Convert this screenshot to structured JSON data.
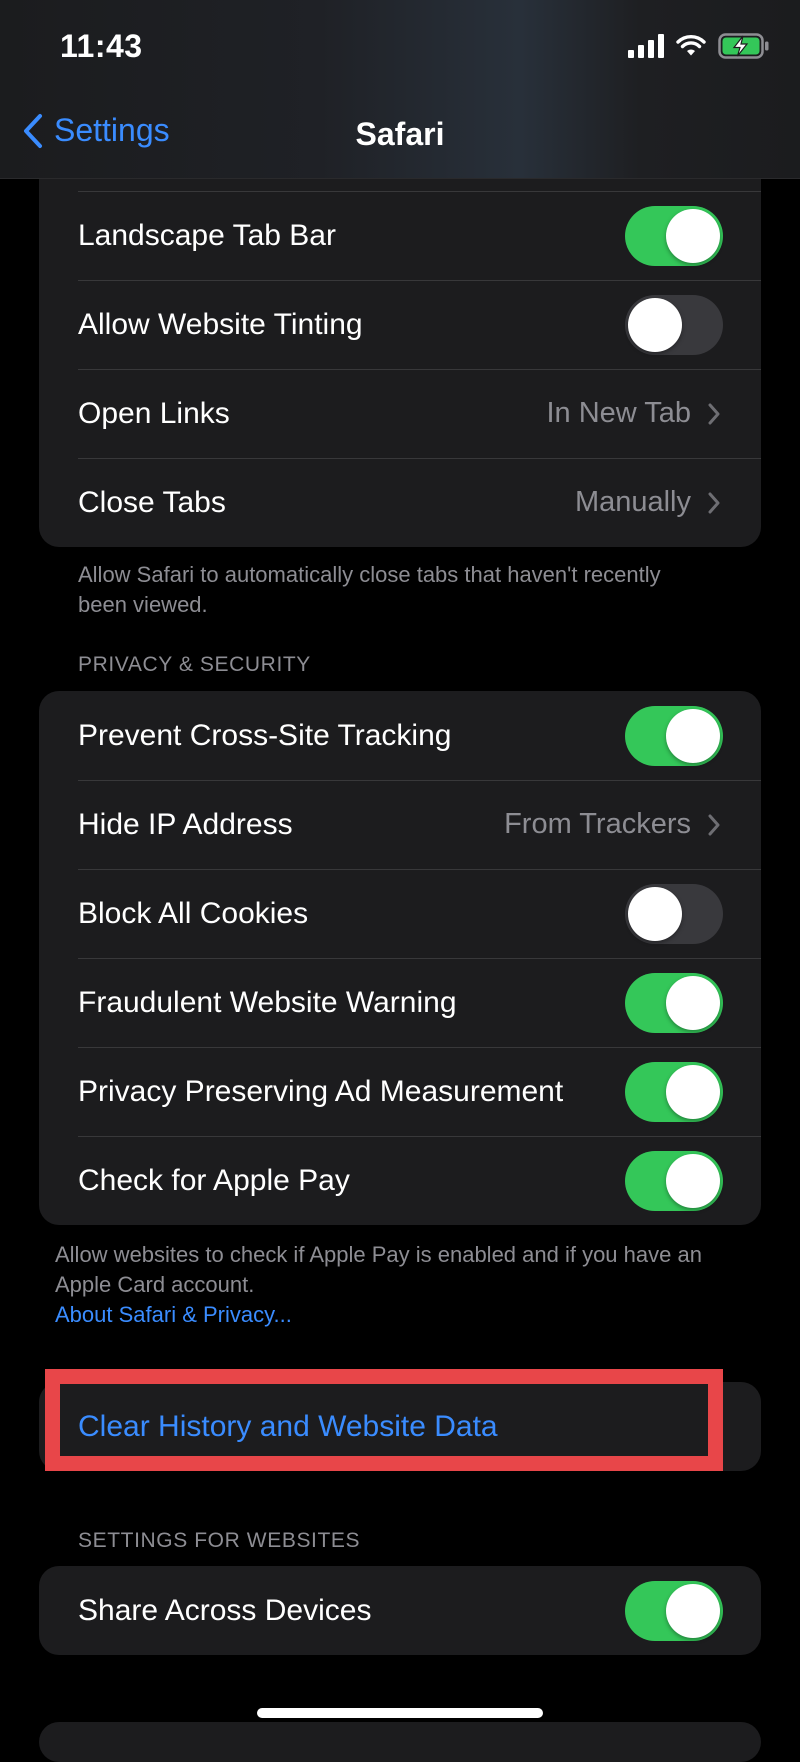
{
  "status": {
    "time": "11:43"
  },
  "nav": {
    "back_label": "Settings",
    "title": "Safari"
  },
  "tabs_group": {
    "rows": [
      {
        "label": "Landscape Tab Bar",
        "toggle": true
      },
      {
        "label": "Allow Website Tinting",
        "toggle": false
      },
      {
        "label": "Open Links",
        "value": "In New Tab"
      },
      {
        "label": "Close Tabs",
        "value": "Manually"
      }
    ],
    "footer": "Allow Safari to automatically close tabs that haven't recently been viewed."
  },
  "privacy": {
    "header": "PRIVACY & SECURITY",
    "rows": [
      {
        "label": "Prevent Cross-Site Tracking",
        "toggle": true
      },
      {
        "label": "Hide IP Address",
        "value": "From Trackers"
      },
      {
        "label": "Block All Cookies",
        "toggle": false
      },
      {
        "label": "Fraudulent Website Warning",
        "toggle": true
      },
      {
        "label": "Privacy Preserving Ad Measurement",
        "toggle": true
      },
      {
        "label": "Check for Apple Pay",
        "toggle": true
      }
    ],
    "footer": "Allow websites to check if Apple Pay is enabled and if you have an Apple Card account.",
    "footer_link": "About Safari & Privacy..."
  },
  "clear": {
    "label": "Clear History and Website Data"
  },
  "websites": {
    "header": "SETTINGS FOR WEBSITES",
    "rows": [
      {
        "label": "Share Across Devices",
        "toggle": true
      }
    ]
  },
  "colors": {
    "accent": "#3a8cff",
    "toggle_on": "#34c759",
    "toggle_off": "#39393d",
    "highlight": "#e84649"
  }
}
